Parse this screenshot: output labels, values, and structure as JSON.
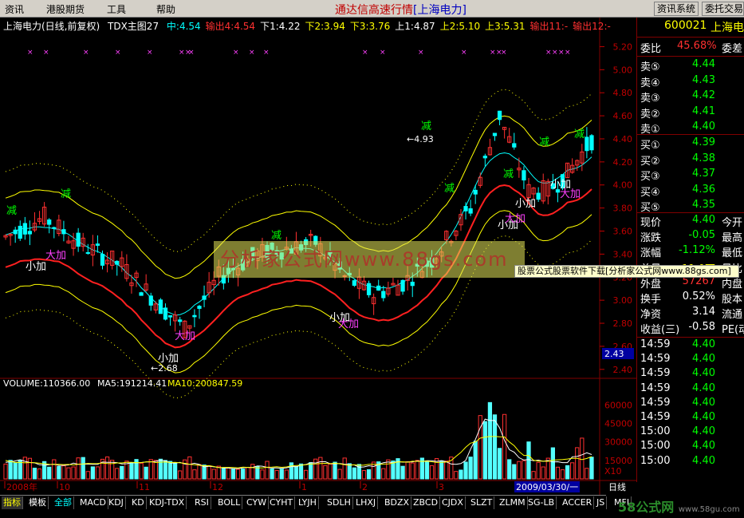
{
  "menu": {
    "items": [
      "资讯",
      "港股期货",
      "工具",
      "帮助"
    ],
    "app_title": "通达信高速行情",
    "stock_tag": "[上海电力]",
    "right_buttons": [
      "资讯系统",
      "委托交易"
    ]
  },
  "chart": {
    "title": "上海电力(日线,前复权)",
    "indicator": "TDX主图27",
    "legend": [
      {
        "text": "中:4.54",
        "color": "#00ffff"
      },
      {
        "text": "输出4:4.54",
        "color": "#ff3030"
      },
      {
        "text": "下1:4.22",
        "color": "#ffffff"
      },
      {
        "text": "下2:3.94",
        "color": "#ffff00"
      },
      {
        "text": "下3:3.76",
        "color": "#ffff00"
      },
      {
        "text": "上1:4.87",
        "color": "#ffffff"
      },
      {
        "text": "上2:5.10",
        "color": "#ffff00"
      },
      {
        "text": "上3:5.31",
        "color": "#ffff00"
      },
      {
        "text": "输出11:-",
        "color": "#ff3030"
      },
      {
        "text": "输出12:-",
        "color": "#ff3030"
      }
    ],
    "price_ticks": [
      "5.20",
      "5.00",
      "4.80",
      "4.60",
      "4.40",
      "4.20",
      "4.00",
      "3.80",
      "3.60",
      "3.40",
      "3.20",
      "3.00",
      "2.80",
      "2.60",
      "2.40"
    ],
    "current_price_tag": "2.43",
    "annotations": {
      "high": "4.93",
      "low": "2.68",
      "reduce": "减",
      "small_add": "小加",
      "big_add": "大加"
    },
    "volume_info": {
      "vol": "VOLUME:110366.00",
      "ma5": "MA5:191214.41",
      "ma10": "MA10:200847.59"
    },
    "volume_ticks": [
      "60000",
      "45000",
      "30000",
      "15000"
    ],
    "volume_unit": "X10",
    "date_axis": [
      "2008年",
      "10",
      "11",
      "12",
      "1",
      "2",
      "3"
    ],
    "cursor_date": "2009/03/30/一",
    "period": "日线"
  },
  "quote": {
    "code": "600021",
    "name": "上海电力",
    "weibi_label": "委比",
    "weibi": "45.68%",
    "weicha_label": "委差",
    "asks": [
      {
        "label": "卖⑤",
        "price": "4.44"
      },
      {
        "label": "卖④",
        "price": "4.43"
      },
      {
        "label": "卖③",
        "price": "4.42"
      },
      {
        "label": "卖②",
        "price": "4.41"
      },
      {
        "label": "卖①",
        "price": "4.40"
      }
    ],
    "bids": [
      {
        "label": "买①",
        "price": "4.39"
      },
      {
        "label": "买②",
        "price": "4.38"
      },
      {
        "label": "买③",
        "price": "4.37"
      },
      {
        "label": "买④",
        "price": "4.36"
      },
      {
        "label": "买⑤",
        "price": "4.35"
      }
    ],
    "stats": [
      {
        "label": "现价",
        "value": "4.40",
        "extra": "今开",
        "color": "#00ff00"
      },
      {
        "label": "涨跌",
        "value": "-0.05",
        "extra": "最高",
        "color": "#00ff00"
      },
      {
        "label": "涨幅",
        "value": "-1.12%",
        "extra": "最低",
        "color": "#00ff00"
      },
      {
        "label": "总量",
        "value": "11.0万",
        "extra": "量比",
        "color": "#ffff00"
      },
      {
        "label": "外盘",
        "value": "57267",
        "extra": "内盘",
        "color": "#ff3030"
      },
      {
        "label": "换手",
        "value": "0.52%",
        "extra": "股本",
        "color": "#ffffff"
      },
      {
        "label": "净资",
        "value": "3.14",
        "extra": "流通",
        "color": "#ffffff"
      },
      {
        "label": "收益(三)",
        "value": "-0.58",
        "extra": "PE(动",
        "color": "#ffffff"
      }
    ],
    "ticks": [
      {
        "time": "14:59",
        "price": "4.40"
      },
      {
        "time": "14:59",
        "price": "4.40"
      },
      {
        "time": "14:59",
        "price": "4.40"
      },
      {
        "time": "14:59",
        "price": "4.40"
      },
      {
        "time": "14:59",
        "price": "4.40"
      },
      {
        "time": "14:59",
        "price": "4.40"
      },
      {
        "time": "15:00",
        "price": "4.40"
      },
      {
        "time": "15:00",
        "price": "4.40"
      },
      {
        "time": "15:00",
        "price": "4.40"
      }
    ]
  },
  "tabs": [
    "指标",
    "模板",
    "全部",
    "MACD",
    "KDJ",
    "KD",
    "KDJ-TDX",
    "RSI",
    "BOLL",
    "CYW",
    "CYHT",
    "LYJH",
    "SDLH",
    "LHXJ",
    "BDZX",
    "ZBCD",
    "CJDX",
    "SLZT",
    "ZLMM",
    "SG-LB",
    "ACCER",
    "JS",
    "MFI"
  ],
  "watermark": "分析家公式网www.88gs.com",
  "ad_banner": "股票公式股票软件下载[分析家公式网www.88gs.com]",
  "logo": "58公式网",
  "logo_url": "www.58gu.com",
  "colors": {
    "up": "#ff3030",
    "down": "#00ffff",
    "up_bar": "#ff3030",
    "down_bar": "#54ffff",
    "mid_line": "#00ffff",
    "lower_red": "#ff2020",
    "band": "#ffff00"
  }
}
